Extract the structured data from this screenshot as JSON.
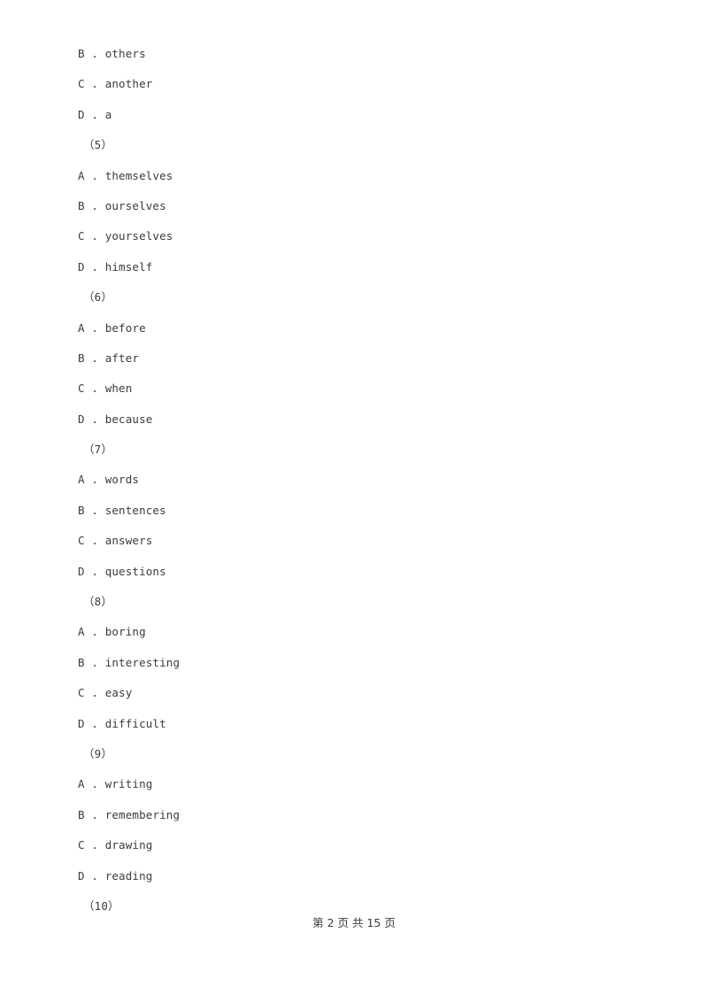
{
  "page": {
    "background_color": "#ffffff",
    "text_color": "#3b3b3b"
  },
  "body_lines": [
    {
      "kind": "option",
      "text": "B . others"
    },
    {
      "kind": "option",
      "text": "C . another"
    },
    {
      "kind": "option",
      "text": "D . a"
    },
    {
      "kind": "qnum",
      "text": "（5）"
    },
    {
      "kind": "option",
      "text": "A . themselves"
    },
    {
      "kind": "option",
      "text": "B . ourselves"
    },
    {
      "kind": "option",
      "text": "C . yourselves"
    },
    {
      "kind": "option",
      "text": "D . himself"
    },
    {
      "kind": "qnum",
      "text": "（6）"
    },
    {
      "kind": "option",
      "text": "A . before"
    },
    {
      "kind": "option",
      "text": "B . after"
    },
    {
      "kind": "option",
      "text": "C . when"
    },
    {
      "kind": "option",
      "text": "D . because"
    },
    {
      "kind": "qnum",
      "text": "（7）"
    },
    {
      "kind": "option",
      "text": "A . words"
    },
    {
      "kind": "option",
      "text": "B . sentences"
    },
    {
      "kind": "option",
      "text": "C . answers"
    },
    {
      "kind": "option",
      "text": "D . questions"
    },
    {
      "kind": "qnum",
      "text": "（8）"
    },
    {
      "kind": "option",
      "text": "A . boring"
    },
    {
      "kind": "option",
      "text": "B . interesting"
    },
    {
      "kind": "option",
      "text": "C . easy"
    },
    {
      "kind": "option",
      "text": "D . difficult"
    },
    {
      "kind": "qnum",
      "text": "（9）"
    },
    {
      "kind": "option",
      "text": "A . writing"
    },
    {
      "kind": "option",
      "text": "B . remembering"
    },
    {
      "kind": "option",
      "text": "C . drawing"
    },
    {
      "kind": "option",
      "text": "D . reading"
    },
    {
      "kind": "qnum",
      "text": "（10）"
    }
  ],
  "footer": {
    "text": "第 2 页 共 15 页",
    "current_page": "2",
    "total_pages": "15"
  }
}
